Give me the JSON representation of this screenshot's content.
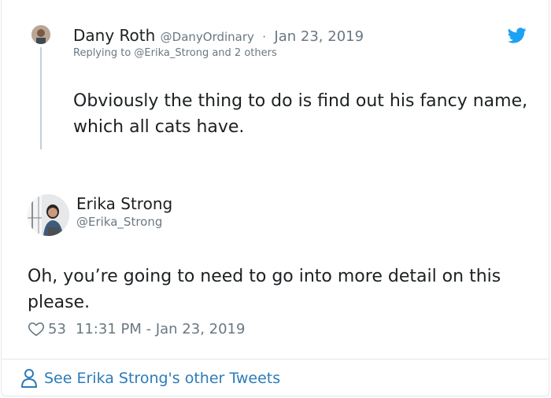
{
  "parent_tweet": {
    "name": "Dany Roth",
    "handle": "@DanyOrdinary",
    "separator": "·",
    "date": "Jan 23, 2019",
    "replying_to": "Replying to @Erika_Strong and 2 others",
    "text": "Obviously the thing to do is find out his fancy name, which all cats have."
  },
  "main_tweet": {
    "name": "Erika Strong",
    "handle": "@Erika_Strong",
    "text": "Oh, you’re going to need to go into more detail on this please.",
    "likes": "53",
    "timestamp": "11:31 PM - Jan 23, 2019"
  },
  "footer": {
    "link_label": "See Erika Strong's other Tweets"
  },
  "icons": {
    "brand": "twitter-bird-icon",
    "like": "heart-icon",
    "profile": "person-icon"
  },
  "colors": {
    "twitter_blue": "#1da1f2",
    "link_blue": "#2b7bb9",
    "secondary_text": "#697882",
    "primary_text": "#1c2022",
    "thread_line": "#c4cfd6",
    "border": "#e1e8ed"
  }
}
